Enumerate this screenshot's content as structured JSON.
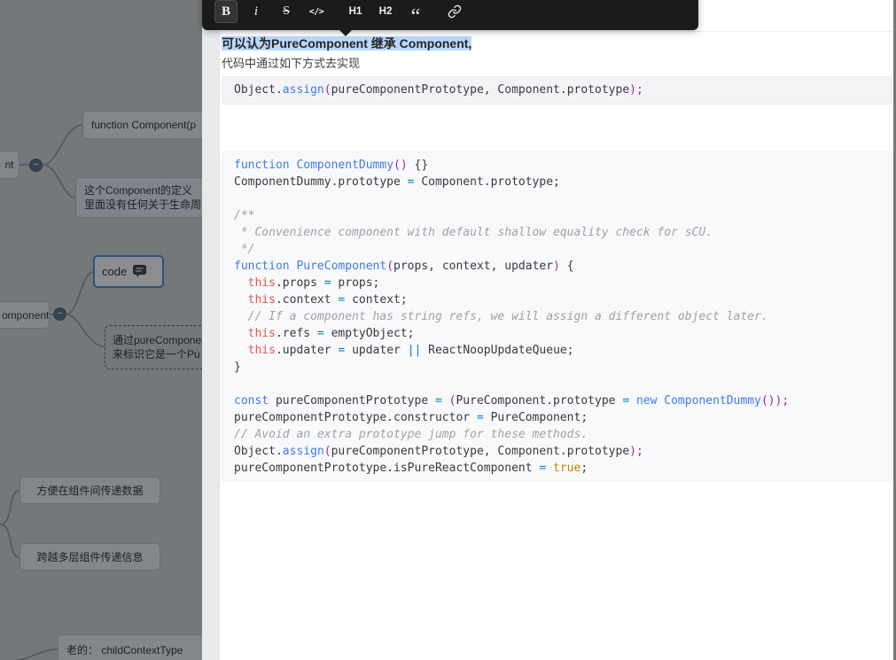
{
  "toolbar": {
    "bold": "B",
    "italic": "i",
    "strike": "S",
    "code": "</>",
    "h1": "H1",
    "h2": "H2",
    "quote": "“"
  },
  "note": {
    "line1": "可以认为PureComponent 继承 Component,",
    "line2": "代码中通过如下方式去实现"
  },
  "colors": {
    "selection_highlight": "#b9d8fc",
    "toolbar_background": "#1b1b1b",
    "keyword_blue": "#4078f2",
    "operator_cyan": "#0184bc",
    "comment_gray": "#a0a1a7",
    "this_red": "#e45649",
    "literal_orange": "#c18401",
    "paren_purple": "#a626a4",
    "code_node_border": "#4a8fe2"
  },
  "code_block_1": {
    "lines": [
      [
        [
          "p",
          "Object."
        ],
        [
          "k",
          "assign"
        ],
        [
          "pu",
          "("
        ],
        [
          "p",
          "pureComponentPrototype, Component.prototype"
        ],
        [
          "pu",
          ");"
        ]
      ]
    ]
  },
  "code_block_2": {
    "lines": [
      [
        [
          "k",
          "function "
        ],
        [
          "fn",
          "ComponentDummy"
        ],
        [
          "pu",
          "()"
        ],
        [
          "p",
          " {}"
        ]
      ],
      [
        [
          "p",
          "ComponentDummy.prototype "
        ],
        [
          "o",
          "="
        ],
        [
          "p",
          " Component.prototype;"
        ]
      ],
      [],
      [
        [
          "c",
          "/**"
        ]
      ],
      [
        [
          "c",
          " * Convenience component with default shallow equality check for sCU."
        ]
      ],
      [
        [
          "c",
          " */"
        ]
      ],
      [
        [
          "k",
          "function "
        ],
        [
          "fn",
          "PureComponent"
        ],
        [
          "pu",
          "("
        ],
        [
          "p",
          "props, context, updater"
        ],
        [
          "pu",
          ")"
        ],
        [
          "p",
          " {"
        ]
      ],
      [
        [
          "p",
          "  "
        ],
        [
          "t",
          "this"
        ],
        [
          "p",
          ".props "
        ],
        [
          "o",
          "="
        ],
        [
          "p",
          " props;"
        ]
      ],
      [
        [
          "p",
          "  "
        ],
        [
          "t",
          "this"
        ],
        [
          "p",
          ".context "
        ],
        [
          "o",
          "="
        ],
        [
          "p",
          " context;"
        ]
      ],
      [
        [
          "c",
          "  // If a component has string refs, we will assign a different object later."
        ]
      ],
      [
        [
          "p",
          "  "
        ],
        [
          "t",
          "this"
        ],
        [
          "p",
          ".refs "
        ],
        [
          "o",
          "="
        ],
        [
          "p",
          " emptyObject;"
        ]
      ],
      [
        [
          "p",
          "  "
        ],
        [
          "t",
          "this"
        ],
        [
          "p",
          ".updater "
        ],
        [
          "o",
          "="
        ],
        [
          "p",
          " updater "
        ],
        [
          "o",
          "||"
        ],
        [
          "p",
          " ReactNoopUpdateQueue;"
        ]
      ],
      [
        [
          "p",
          "}"
        ]
      ],
      [],
      [
        [
          "k",
          "const"
        ],
        [
          "p",
          " pureComponentPrototype "
        ],
        [
          "o",
          "="
        ],
        [
          "p",
          " "
        ],
        [
          "pu",
          "("
        ],
        [
          "p",
          "PureComponent.prototype "
        ],
        [
          "o",
          "="
        ],
        [
          "p",
          " "
        ],
        [
          "k",
          "new"
        ],
        [
          "p",
          " "
        ],
        [
          "fn",
          "ComponentDummy"
        ],
        [
          "pu",
          "());"
        ]
      ],
      [
        [
          "p",
          "pureComponentPrototype.constructor "
        ],
        [
          "o",
          "="
        ],
        [
          "p",
          " PureComponent;"
        ]
      ],
      [
        [
          "c",
          "// Avoid an extra prototype jump for these methods."
        ]
      ],
      [
        [
          "p",
          "Object."
        ],
        [
          "k",
          "assign"
        ],
        [
          "pu",
          "("
        ],
        [
          "p",
          "pureComponentPrototype, Component.prototype"
        ],
        [
          "pu",
          ");"
        ]
      ],
      [
        [
          "p",
          "pureComponentPrototype.isPureReactComponent "
        ],
        [
          "o",
          "="
        ],
        [
          "p",
          " "
        ],
        [
          "l",
          "true"
        ],
        [
          "p",
          ";"
        ]
      ]
    ]
  },
  "mindmap": {
    "collapse_glyph": "−",
    "node_partial_top": "nt",
    "node_function": "function Component(p",
    "node_def_line1": "这个Component的定义",
    "node_def_line2": "里面没有任何关于生命周",
    "node_code": "code",
    "node_dashed_line1": "通过pureComponen",
    "node_dashed_line2": "来标识它是一个Pu",
    "node_partial_mid": "omponent",
    "node_pass": "方便在组件间传递数据",
    "node_cross": "跨越多层组件传递信息",
    "node_old": "老的： childContextType"
  }
}
